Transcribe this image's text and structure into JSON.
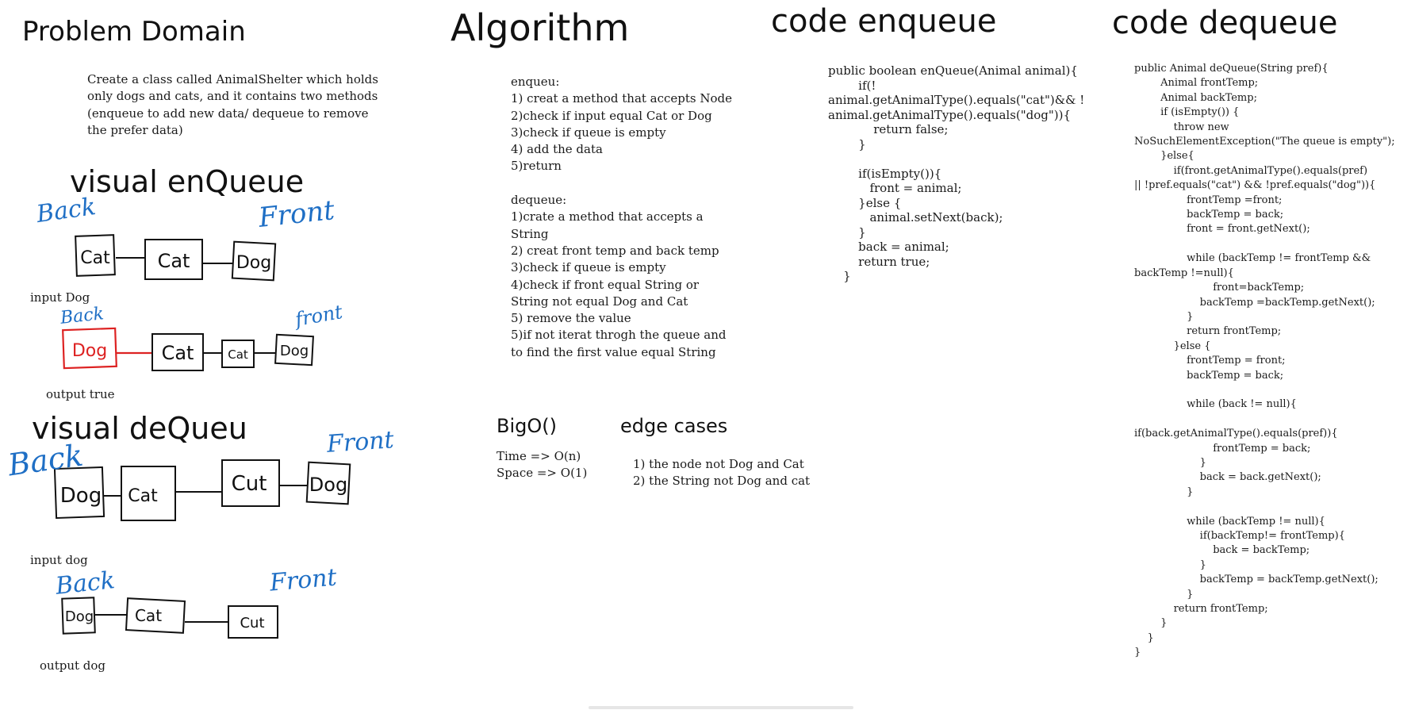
{
  "problem": {
    "heading": "Problem Domain",
    "text": "Create a class called AnimalShelter which holds\nonly dogs and cats, and it contains two methods\n(enqueue to add new data/ dequeue to remove\nthe prefer data)"
  },
  "algorithm": {
    "heading": "Algorithm",
    "text": "enqueu:\n1) creat a method that accepts Node\n2)check if input equal Cat or Dog\n3)check if queue is empty\n4) add the data\n5)return\n\ndequeue:\n1)crate a method that accepts a\nString\n2) creat front temp and back temp\n3)check if queue is empty\n4)check if front equal String or\nString not equal Dog and Cat\n5) remove the value\n5)if not iterat throgh the queue and\nto find the first value equal String"
  },
  "bigo": {
    "heading": "BigO()",
    "text": "Time => O(n)\nSpace => O(1)"
  },
  "edge_cases": {
    "heading": "edge cases",
    "text": "1) the node not Dog and Cat\n2) the String not Dog and cat"
  },
  "code_enqueue": {
    "heading": "code  enqueue",
    "code": "public boolean enQueue(Animal animal){\n        if(!\nanimal.getAnimalType().equals(\"cat\")&& !\nanimal.getAnimalType().equals(\"dog\")){\n            return false;\n        }\n\n        if(isEmpty()){\n           front = animal;\n        }else {\n           animal.setNext(back);\n        }\n        back = animal;\n        return true;\n    }"
  },
  "code_dequeue": {
    "heading": "code  dequeue",
    "code": "public Animal deQueue(String pref){\n        Animal frontTemp;\n        Animal backTemp;\n        if (isEmpty()) {\n            throw new\nNoSuchElementException(\"The queue is empty\");\n        }else{\n            if(front.getAnimalType().equals(pref)\n|| !pref.equals(\"cat\") && !pref.equals(\"dog\")){\n                frontTemp =front;\n                backTemp = back;\n                front = front.getNext();\n\n                while (backTemp != frontTemp &&\nbackTemp !=null){\n                        front=backTemp;\n                    backTemp =backTemp.getNext();\n                }\n                return frontTemp;\n            }else {\n                frontTemp = front;\n                backTemp = back;\n\n                while (back != null){\n\nif(back.getAnimalType().equals(pref)){\n                        frontTemp = back;\n                    }\n                    back = back.getNext();\n                }\n\n                while (backTemp != null){\n                    if(backTemp!= frontTemp){\n                        back = backTemp;\n                    }\n                    backTemp = backTemp.getNext();\n                }\n            return frontTemp;\n        }\n    }\n}"
  },
  "visual_enqueue": {
    "heading": "visual enQueue",
    "back_label": "Back",
    "front_label": "Front",
    "row1_boxes": [
      "Cat",
      "Cat",
      "Dog"
    ],
    "input_label": "input Dog",
    "back_label_2": "Back",
    "front_label_2": "front",
    "row2_boxes": [
      "Dog",
      "Cat",
      "Cat",
      "Dog"
    ],
    "output_label": "output true"
  },
  "visual_dequeue": {
    "heading": "visual deQueu",
    "back_label": "Back",
    "front_label": "Front",
    "row1_boxes": [
      "Dog",
      "Cat",
      "Cut",
      "Dog"
    ],
    "input_label": "input  dog",
    "back_label_2": "Back",
    "front_label_2": "Front",
    "row2_boxes": [
      "Dog",
      "Cat",
      "Cut"
    ],
    "output_label": "output dog"
  },
  "colors": {
    "ink": "#111111",
    "highlight_red": "#dd2222",
    "annotation_blue": "#1f6fc5"
  }
}
